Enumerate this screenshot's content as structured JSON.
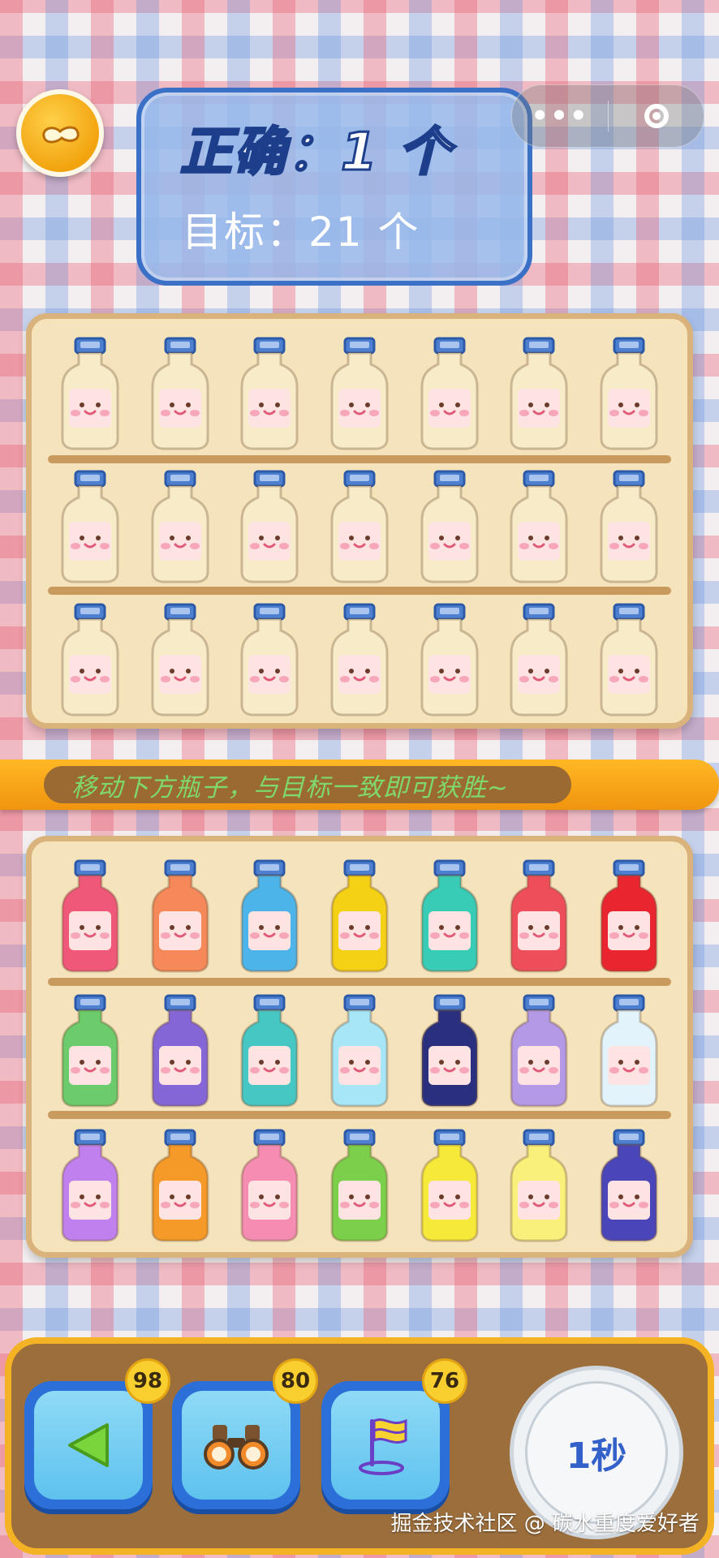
{
  "hud": {
    "correct_text": "正确：1 个",
    "target_text": "目标：21 个"
  },
  "capsule": {
    "more_label": "•••",
    "close_icon": "target-circle-icon"
  },
  "hint": {
    "text": "移动下方瓶子，与目标一致即可获胜~"
  },
  "target_shelf": {
    "rows": [
      [
        "#f8ebc8",
        "#f8ebc8",
        "#f8ebc8",
        "#f8ebc8",
        "#f8ebc8",
        "#f8ebc8",
        "#f8ebc8"
      ],
      [
        "#f8ebc8",
        "#f8ebc8",
        "#f8ebc8",
        "#f8ebc8",
        "#f8ebc8",
        "#f8ebc8",
        "#f8ebc8"
      ],
      [
        "#f8ebc8",
        "#f8ebc8",
        "#f8ebc8",
        "#f8ebc8",
        "#f8ebc8",
        "#f8ebc8",
        "#f8ebc8"
      ]
    ]
  },
  "player_shelf": {
    "rows": [
      [
        "#f0587a",
        "#f5895a",
        "#4cb4e8",
        "#f5d116",
        "#38cbb6",
        "#ee4e5a",
        "#e9262f"
      ],
      [
        "#6ccb6a",
        "#8466d6",
        "#46c7c4",
        "#a6e6f6",
        "#2a2f7e",
        "#b49ae6",
        "#e2f3fb"
      ],
      [
        "#c080ee",
        "#f59a28",
        "#f58cb2",
        "#7ccf4a",
        "#f6e93a",
        "#f7f07a",
        "#4a45b8"
      ]
    ]
  },
  "toolbar": {
    "undo": {
      "icon": "back-triangle-icon",
      "count": "98"
    },
    "peek": {
      "icon": "binoculars-icon",
      "count": "80"
    },
    "flag": {
      "icon": "flag-icon",
      "count": "76"
    },
    "timer_text": "1秒"
  },
  "watermark": "掘金技术社区 @ 碳水重度爱好者"
}
